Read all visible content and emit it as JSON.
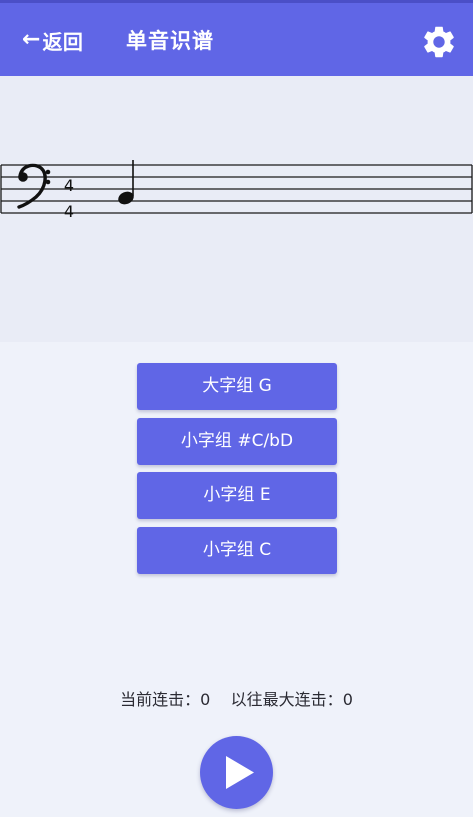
{
  "header": {
    "back_arrow": "←",
    "back_label": "返回",
    "title": "单音识谱",
    "settings_icon": "gear-icon"
  },
  "staff": {
    "clef": "bass-clef",
    "time_signature": {
      "top": "4",
      "bottom": "4"
    },
    "note": "quarter-note"
  },
  "answers": [
    {
      "label": "大字组 G"
    },
    {
      "label": "小字组 #C/bD"
    },
    {
      "label": "小字组 E"
    },
    {
      "label": "小字组 C"
    }
  ],
  "stats": {
    "current_label": "当前连击：",
    "current_value": "0",
    "max_label": "以往最大连击：",
    "max_value": "0"
  },
  "play_icon": "play-icon",
  "colors": {
    "accent": "#6066e6",
    "background": "#eff2fa",
    "staff_background": "#e9ecf6"
  }
}
